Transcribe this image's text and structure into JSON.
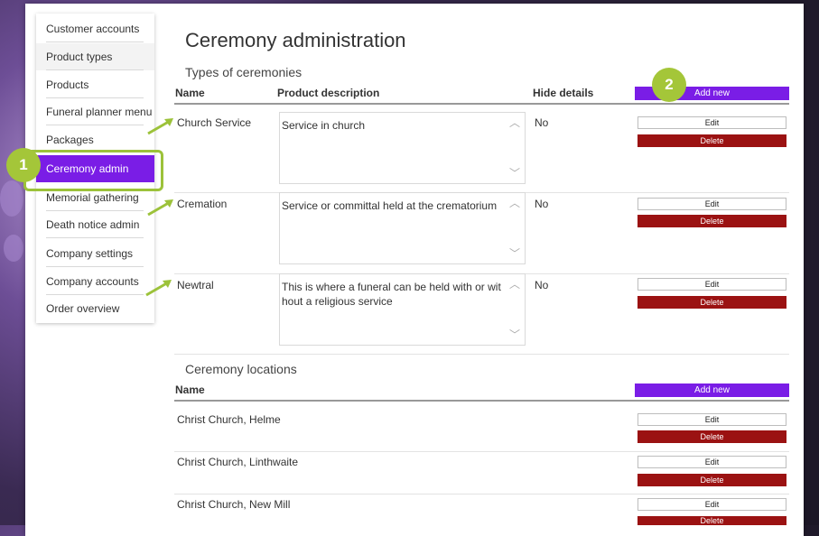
{
  "sidebar": {
    "items": [
      {
        "label": "Customer accounts"
      },
      {
        "label": "Product types"
      },
      {
        "label": "Products"
      },
      {
        "label": "Funeral planner menu"
      },
      {
        "label": "Packages"
      },
      {
        "label": "Ceremony admin"
      },
      {
        "label": "Memorial gathering"
      },
      {
        "label": "Death notice admin"
      },
      {
        "label": "Company settings"
      },
      {
        "label": "Company accounts"
      },
      {
        "label": "Order overview"
      }
    ],
    "active_index": 5
  },
  "callouts": {
    "one": "1",
    "two": "2"
  },
  "page_title": "Ceremony administration",
  "ceremonies": {
    "section_title": "Types of ceremonies",
    "headers": {
      "name": "Name",
      "description": "Product description",
      "hide": "Hide details"
    },
    "add_label": "Add new",
    "rows": [
      {
        "name": "Church Service",
        "description": "Service in church",
        "hide": "No"
      },
      {
        "name": "Cremation",
        "description": "Service or committal held at the crematorium",
        "hide": "No"
      },
      {
        "name": "Newtral",
        "description": "This is where a funeral can be held with or without a religious service",
        "hide": "No"
      }
    ]
  },
  "locations": {
    "section_title": "Ceremony locations",
    "headers": {
      "name": "Name"
    },
    "add_label": "Add new",
    "rows": [
      {
        "name": "Christ Church, Helme"
      },
      {
        "name": "Christ Church, Linthwaite"
      },
      {
        "name": "Christ Church, New Mill"
      }
    ]
  },
  "actions": {
    "edit": "Edit",
    "delete": "Delete"
  },
  "colors": {
    "accent": "#7a1de6",
    "delete": "#9b1212",
    "callout": "#a4c639"
  }
}
